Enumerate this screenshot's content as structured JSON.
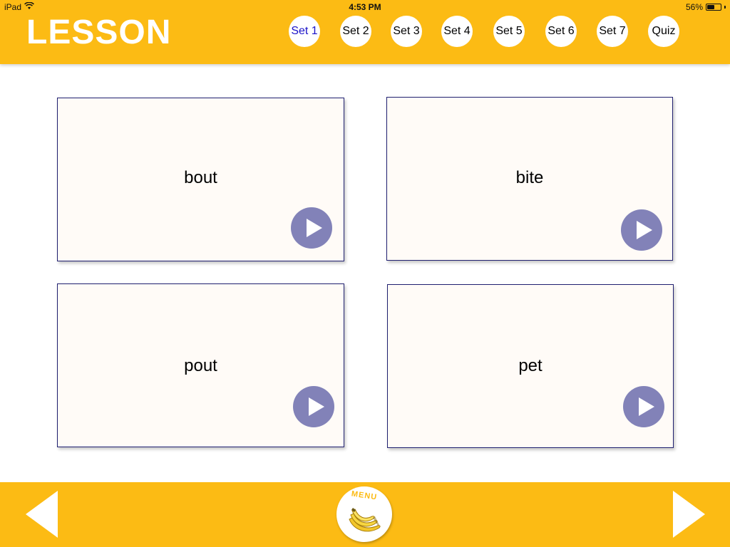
{
  "status": {
    "device": "iPad",
    "time": "4:53 PM",
    "battery": "56%",
    "battery_level": 0.56
  },
  "header": {
    "title": "LESSON",
    "tabs": [
      {
        "label": "Set 1",
        "active": true
      },
      {
        "label": "Set 2",
        "active": false
      },
      {
        "label": "Set 3",
        "active": false
      },
      {
        "label": "Set 4",
        "active": false
      },
      {
        "label": "Set 5",
        "active": false
      },
      {
        "label": "Set 6",
        "active": false
      },
      {
        "label": "Set 7",
        "active": false
      },
      {
        "label": "Quiz",
        "active": false
      }
    ]
  },
  "cards": [
    {
      "word": "bout"
    },
    {
      "word": "bite"
    },
    {
      "word": "pout"
    },
    {
      "word": "pet"
    }
  ],
  "footer": {
    "menu_label": "MENU",
    "menu_icon": "banana-icon",
    "prev_icon": "arrow-left-icon",
    "next_icon": "arrow-right-icon"
  },
  "colors": {
    "bar": "#fcbb14",
    "card_bg": "#fffbf7",
    "play_button": "#8282b8",
    "active_tab_text": "#1a12c8"
  }
}
